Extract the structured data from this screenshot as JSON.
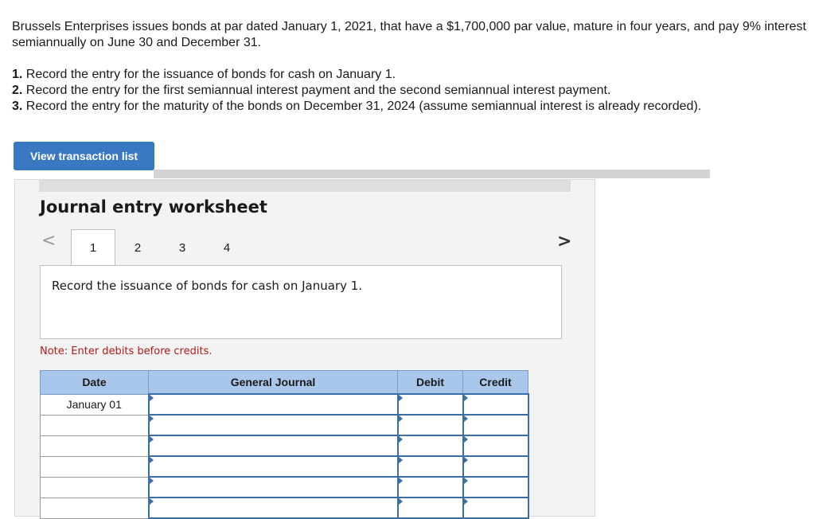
{
  "problem": {
    "text": "Brussels Enterprises issues bonds at par dated January 1, 2021, that have a $1,700,000 par value, mature in four years, and pay 9% interest semiannually on June 30 and December 31.",
    "requirements": [
      {
        "num": "1.",
        "text": " Record the entry for the issuance of bonds for cash on January 1."
      },
      {
        "num": "2.",
        "text": " Record the entry for the first semiannual interest payment and the second semiannual interest payment."
      },
      {
        "num": "3.",
        "text": " Record the entry for the maturity of the bonds on December 31, 2024 (assume semiannual interest is already recorded)."
      }
    ]
  },
  "view_button": "View transaction list",
  "worksheet": {
    "title": "Journal entry worksheet",
    "prev": "<",
    "next": ">",
    "tabs": [
      "1",
      "2",
      "3",
      "4"
    ],
    "active_tab": "1",
    "instruction": "Record the issuance of bonds for cash on January 1.",
    "note": "Note: Enter debits before credits."
  },
  "journal": {
    "headers": {
      "date": "Date",
      "general_journal": "General Journal",
      "debit": "Debit",
      "credit": "Credit"
    },
    "rows": [
      {
        "date": "January 01"
      },
      {
        "date": ""
      },
      {
        "date": ""
      },
      {
        "date": ""
      },
      {
        "date": ""
      },
      {
        "date": ""
      }
    ]
  },
  "colors": {
    "accent": "#3a78c1",
    "header_bg": "#a9c7ea",
    "note": "#b31b1b"
  }
}
